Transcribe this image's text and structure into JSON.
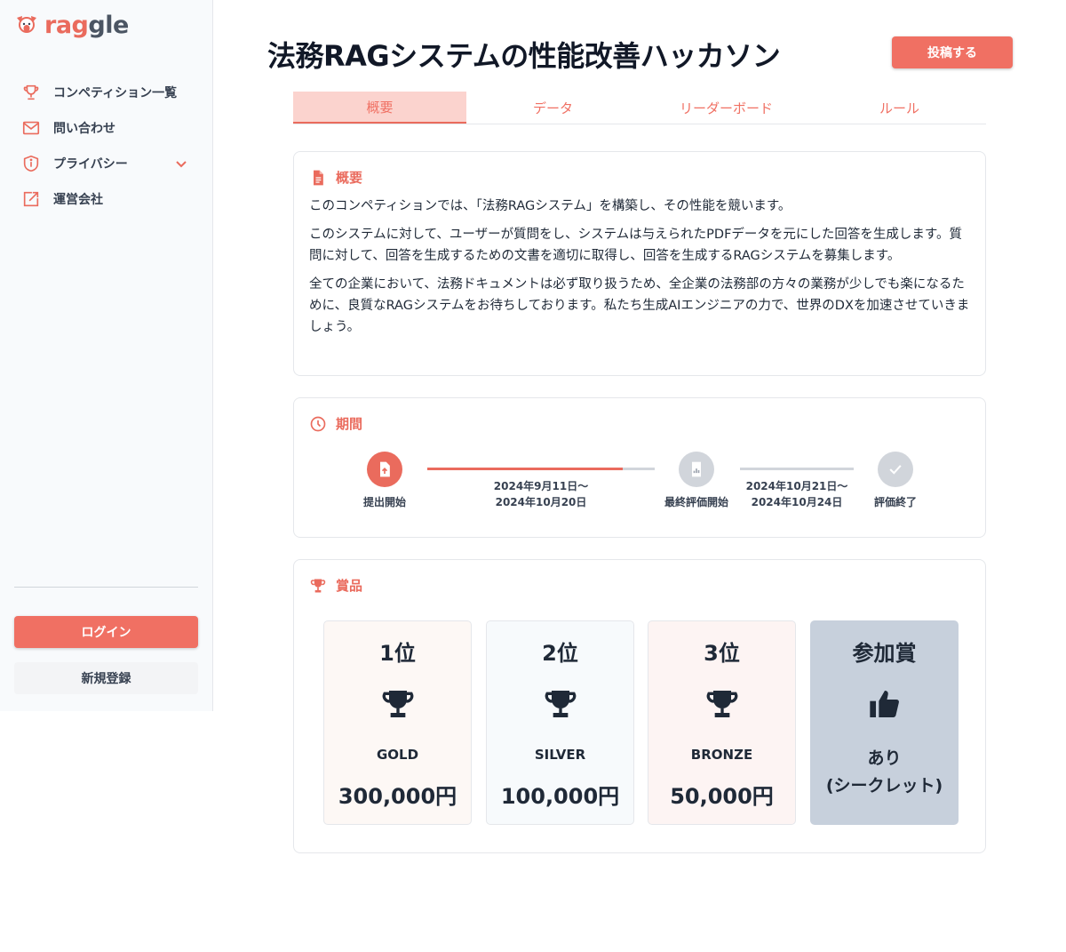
{
  "brand": {
    "name_part1": "rag",
    "name_part2": "gle",
    "accent": "#ea6b5d"
  },
  "sidebar": {
    "items": [
      {
        "label": "コンペティション一覧",
        "icon": "trophy-icon"
      },
      {
        "label": "問い合わせ",
        "icon": "mail-icon"
      },
      {
        "label": "プライバシー",
        "icon": "shield-icon"
      },
      {
        "label": "運営会社",
        "icon": "external-link-icon"
      }
    ],
    "login_label": "ログイン",
    "register_label": "新規登録"
  },
  "header": {
    "title": "法務RAGシステムの性能改善ハッカソン",
    "submit_label": "投稿する"
  },
  "tabs": [
    {
      "label": "概要",
      "active": true
    },
    {
      "label": "データ",
      "active": false
    },
    {
      "label": "リーダーボード",
      "active": false
    },
    {
      "label": "ルール",
      "active": false
    }
  ],
  "overview": {
    "heading": "概要",
    "paragraphs": [
      "このコンペティションでは、「法務RAGシステム」を構築し、その性能を競います。",
      "このシステムに対して、ユーザーが質問をし、システムは与えられたPDFデータを元にした回答を生成します。質問に対して、回答を生成するための文書を適切に取得し、回答を生成するRAGシステムを募集します。",
      "全ての企業において、法務ドキュメントは必ず取り扱うため、全企業の法務部の方々の業務が少しでも楽になるために、良質なRAGシステムをお待ちしております。私たち生成AIエンジニアの力で、世界のDXを加速させていきましょう。"
    ]
  },
  "period": {
    "heading": "期間",
    "steps": [
      {
        "label": "提出開始",
        "state": "active"
      },
      {
        "label": "最終評価開始",
        "state": "pending"
      },
      {
        "label": "評価終了",
        "state": "pending"
      }
    ],
    "ranges": [
      {
        "start": "2024年9月11日〜",
        "end": "2024年10月20日",
        "progress": 0.86
      },
      {
        "start": "2024年10月21日〜",
        "end": "2024年10月24日",
        "progress": 0
      }
    ]
  },
  "prizes": {
    "heading": "賞品",
    "items": [
      {
        "rank": "1位",
        "tier": "GOLD",
        "amount": "300,000円",
        "bg": "#fdf8f5"
      },
      {
        "rank": "2位",
        "tier": "SILVER",
        "amount": "100,000円",
        "bg": "#f7fafc"
      },
      {
        "rank": "3位",
        "tier": "BRONZE",
        "amount": "50,000円",
        "bg": "#fdf4f3"
      }
    ],
    "participation": {
      "rank": "参加賞",
      "line1": "あり",
      "line2": "(シークレット)",
      "bg": "#c7d0dc"
    }
  }
}
